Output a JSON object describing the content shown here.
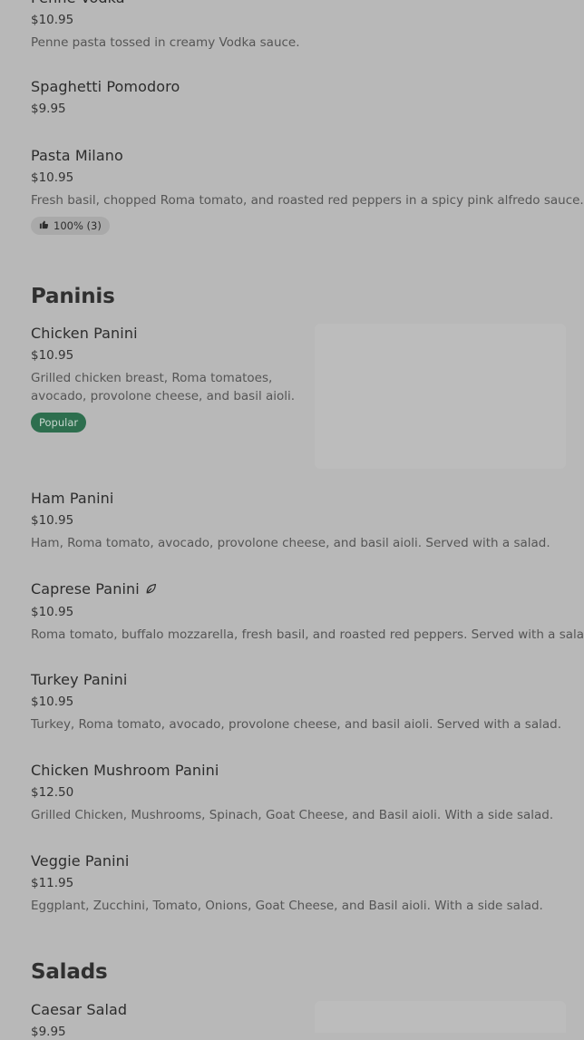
{
  "items": {
    "penne_vodka": {
      "name": "Penne Vodka",
      "price": "$10.95",
      "desc": "Penne pasta tossed in creamy Vodka sauce."
    },
    "spaghetti_pomodoro": {
      "name": "Spaghetti Pomodoro",
      "price": "$9.95"
    },
    "pasta_milano": {
      "name": "Pasta Milano",
      "price": "$10.95",
      "desc": "Fresh basil, chopped Roma tomato, and roasted red peppers in a spicy pink alfredo sauce.",
      "rating": "100% (3)"
    },
    "chicken_panini": {
      "name": "Chicken Panini",
      "price": "$10.95",
      "desc_line1": "Grilled chicken breast, Roma tomatoes,",
      "desc_line2": "avocado, provolone cheese, and basil aioli.",
      "badge": "Popular"
    },
    "ham_panini": {
      "name": "Ham Panini",
      "price": "$10.95",
      "desc": "Ham, Roma tomato, avocado, provolone cheese, and basil aioli. Served with a salad."
    },
    "caprese_panini": {
      "name": "Caprese Panini",
      "price": "$10.95",
      "desc": "Roma tomato, buffalo mozzarella, fresh basil, and roasted red peppers. Served with a salad."
    },
    "turkey_panini": {
      "name": "Turkey Panini",
      "price": "$10.95",
      "desc": "Turkey, Roma tomato, avocado, provolone cheese, and basil aioli. Served with a salad."
    },
    "chicken_mushroom_panini": {
      "name": "Chicken Mushroom Panini",
      "price": "$12.50",
      "desc": "Grilled Chicken, Mushrooms, Spinach, Goat Cheese, and Basil aioli. With a side salad."
    },
    "veggie_panini": {
      "name": "Veggie Panini",
      "price": "$11.95",
      "desc": "Eggplant, Zucchini, Tomato, Onions, Goat Cheese, and Basil aioli. With a side salad."
    },
    "caesar_salad": {
      "name": "Caesar Salad",
      "price": "$9.95"
    }
  },
  "sections": {
    "paninis": "Paninis",
    "salads": "Salads"
  },
  "icons": {
    "rating": "thumbs-up-icon",
    "vegetarian": "leaf-icon"
  },
  "colors": {
    "background": "#b8b8b8",
    "popular_badge": "#2d6e4e"
  }
}
